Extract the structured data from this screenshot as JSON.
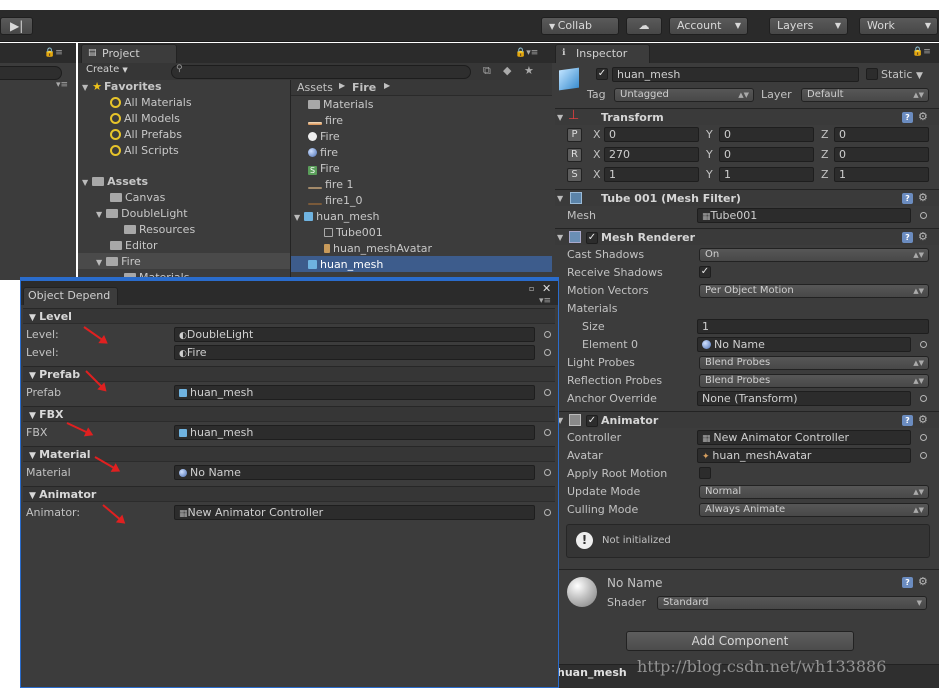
{
  "toolbar": {
    "collab": "Collab",
    "account": "Account",
    "layers": "Layers",
    "layout": "Work"
  },
  "project": {
    "tab": "Project",
    "create": "Create",
    "favorites_label": "Favorites",
    "favorites": [
      "All Materials",
      "All Models",
      "All Prefabs",
      "All Scripts"
    ],
    "assets_label": "Assets",
    "folders": [
      "Canvas",
      "DoubleLight",
      "Resources",
      "Editor",
      "Fire",
      "Materials"
    ],
    "breadcrumb": [
      "Assets",
      "Fire"
    ],
    "files": [
      "Materials",
      "fire",
      "Fire",
      "fire",
      "Fire",
      "fire 1",
      "fire1_0",
      "huan_mesh",
      "Tube001",
      "huan_meshAvatar",
      "huan_mesh"
    ]
  },
  "inspector": {
    "tab": "Inspector",
    "object_name": "huan_mesh",
    "static_label": "Static",
    "tag_label": "Tag",
    "tag_value": "Untagged",
    "layer_label": "Layer",
    "layer_value": "Default",
    "transform": {
      "title": "Transform",
      "rows": [
        {
          "btn": "P",
          "x": "0",
          "y": "0",
          "z": "0"
        },
        {
          "btn": "R",
          "x": "270",
          "y": "0",
          "z": "0"
        },
        {
          "btn": "S",
          "x": "1",
          "y": "1",
          "z": "1"
        }
      ],
      "x_label": "X",
      "y_label": "Y",
      "z_label": "Z"
    },
    "mesh_filter": {
      "title": "Tube 001 (Mesh Filter)",
      "mesh_label": "Mesh",
      "mesh_value": "Tube001"
    },
    "mesh_renderer": {
      "title": "Mesh Renderer",
      "cast_shadows_label": "Cast Shadows",
      "cast_shadows": "On",
      "receive_shadows_label": "Receive Shadows",
      "motion_vectors_label": "Motion Vectors",
      "motion_vectors": "Per Object Motion",
      "materials_label": "Materials",
      "size_label": "Size",
      "size": "1",
      "element0_label": "Element 0",
      "element0": "No Name",
      "light_probes_label": "Light Probes",
      "light_probes": "Blend Probes",
      "reflection_probes_label": "Reflection Probes",
      "reflection_probes": "Blend Probes",
      "anchor_override_label": "Anchor Override",
      "anchor_override": "None (Transform)"
    },
    "animator": {
      "title": "Animator",
      "controller_label": "Controller",
      "controller": "New Animator Controller",
      "avatar_label": "Avatar",
      "avatar": "huan_meshAvatar",
      "apply_root_label": "Apply Root Motion",
      "update_mode_label": "Update Mode",
      "update_mode": "Normal",
      "culling_mode_label": "Culling Mode",
      "culling_mode": "Always Animate",
      "notice": "Not initialized"
    },
    "material": {
      "name": "No Name",
      "shader_label": "Shader",
      "shader": "Standard"
    },
    "add_component": "Add Component",
    "footer_name": "huan_mesh"
  },
  "object_depend": {
    "tab": "Object Depend",
    "sections": [
      {
        "title": "Level",
        "rows": [
          {
            "label": "Level:",
            "value": "DoubleLight"
          },
          {
            "label": "Level:",
            "value": "Fire"
          }
        ]
      },
      {
        "title": "Prefab",
        "rows": [
          {
            "label": "Prefab",
            "value": "huan_mesh"
          }
        ]
      },
      {
        "title": "FBX",
        "rows": [
          {
            "label": "FBX",
            "value": "huan_mesh"
          }
        ]
      },
      {
        "title": "Material",
        "rows": [
          {
            "label": "Material",
            "value": "No Name"
          }
        ]
      },
      {
        "title": "Animator",
        "rows": [
          {
            "label": "Animator:",
            "value": "New Animator Controller"
          }
        ]
      }
    ]
  },
  "watermark": "http://blog.csdn.net/wh133886",
  "colors": {
    "panel_bg": "#3c3c3c",
    "selection": "#3d5c8c",
    "annotation_arrow": "#e02020"
  }
}
